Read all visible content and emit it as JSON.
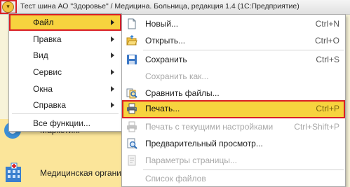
{
  "window": {
    "title": "Тест шина АО \"Здоровье\" / Медицина. Больница, редакция 1.4  (1С:Предприятие)"
  },
  "background": {
    "items": [
      {
        "label": "Маркетинг",
        "icon": "marketing-icon"
      },
      {
        "label": "Медицинская организац",
        "icon": "hospital-building-icon"
      }
    ]
  },
  "main_menu": {
    "items": [
      {
        "label": "Файл",
        "has_submenu": true,
        "active": true
      },
      {
        "label": "Правка",
        "has_submenu": true
      },
      {
        "label": "Вид",
        "has_submenu": true
      },
      {
        "label": "Сервис",
        "has_submenu": true
      },
      {
        "label": "Окна",
        "has_submenu": true
      },
      {
        "label": "Справка",
        "has_submenu": true
      },
      {
        "label": "Все функции...",
        "has_submenu": false
      }
    ]
  },
  "file_menu": {
    "items": [
      {
        "label": "Новый...",
        "shortcut": "Ctrl+N",
        "icon": "new-document-icon",
        "enabled": true
      },
      {
        "label": "Открыть...",
        "shortcut": "Ctrl+O",
        "icon": "open-folder-icon",
        "enabled": true
      },
      {
        "label": "Сохранить",
        "shortcut": "Ctrl+S",
        "icon": "save-icon",
        "enabled": true
      },
      {
        "label": "Сохранить как...",
        "shortcut": "",
        "icon": "",
        "enabled": false
      },
      {
        "label": "Сравнить файлы...",
        "shortcut": "",
        "icon": "compare-files-icon",
        "enabled": true
      },
      {
        "label": "Печать...",
        "shortcut": "Ctrl+P",
        "icon": "print-icon",
        "enabled": true,
        "highlighted": true
      },
      {
        "label": "Печать с текущими настройками",
        "shortcut": "Ctrl+Shift+P",
        "icon": "print-current-settings-icon",
        "enabled": false
      },
      {
        "label": "Предварительный просмотр...",
        "shortcut": "",
        "icon": "print-preview-icon",
        "enabled": true
      },
      {
        "label": "Параметры страницы...",
        "shortcut": "",
        "icon": "page-settings-icon",
        "enabled": false
      },
      {
        "label": "Список файлов",
        "shortcut": "",
        "icon": "",
        "enabled": false
      }
    ]
  },
  "colors": {
    "highlight": "#f7d33e",
    "annotation_outline": "#d91f26",
    "disabled_text": "#a8a8a8"
  }
}
